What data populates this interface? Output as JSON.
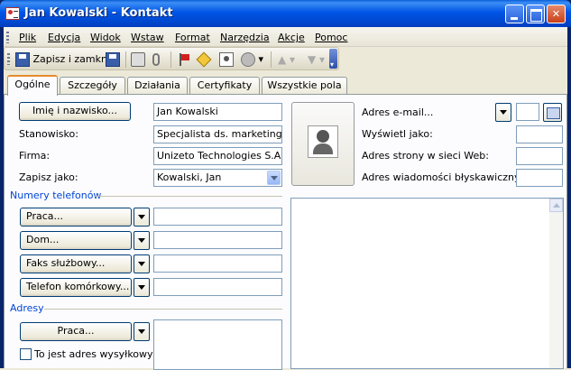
{
  "window": {
    "title": "Jan Kowalski - Kontakt"
  },
  "menu": [
    "Plik",
    "Edycja",
    "Widok",
    "Wstaw",
    "Format",
    "Narzędzia",
    "Akcje",
    "Pomoc"
  ],
  "toolbar": {
    "save_close": "Zapisz i zamknij"
  },
  "tabs": [
    "Ogólne",
    "Szczegóły",
    "Działania",
    "Certyfikaty",
    "Wszystkie pola"
  ],
  "general": {
    "fullname_button": "Imię i nazwisko...",
    "fullname_value": "Jan Kowalski",
    "job_title_label": "Stanowisko:",
    "job_title_value": "Specjalista ds. marketingu",
    "company_label": "Firma:",
    "company_value": "Unizeto Technologies S.A.",
    "file_as_label": "Zapisz jako:",
    "file_as_value": "Kowalski, Jan"
  },
  "phones": {
    "section_title": "Numery telefonów",
    "items": [
      {
        "label": "Praca...",
        "value": ""
      },
      {
        "label": "Dom...",
        "value": ""
      },
      {
        "label": "Faks służbowy...",
        "value": ""
      },
      {
        "label": "Telefon komórkowy...",
        "value": ""
      }
    ]
  },
  "addresses": {
    "section_title": "Adresy",
    "type_button": "Praca...",
    "mailing_checkbox_label": "To jest adres wysyłkowy"
  },
  "internet": {
    "email_label": "Adres e-mail...",
    "display_as_label": "Wyświetl jako:",
    "webpage_label": "Adres strony w sieci Web:",
    "im_label": "Adres wiadomości błyskawicznych:"
  }
}
